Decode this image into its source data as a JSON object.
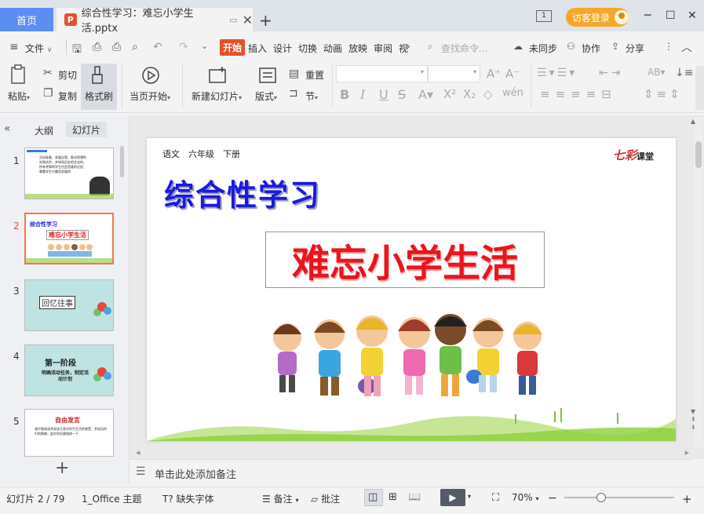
{
  "titlebar": {
    "home_tab": "首页",
    "doc_tab": "综合性学习：难忘小学生活.pptx",
    "window_num": "1",
    "login": "访客登录"
  },
  "menu": {
    "file": "文件",
    "tabs": [
      "开始",
      "插入",
      "设计",
      "切换",
      "动画",
      "放映",
      "审阅",
      "视"
    ],
    "search_placeholder": "查找命令...",
    "sync": "未同步",
    "collab": "协作",
    "share": "分享"
  },
  "ribbon": {
    "paste": "粘贴",
    "cut": "剪切",
    "copy": "复制",
    "format_painter": "格式刷",
    "from_current": "当页开始",
    "new_slide": "新建幻灯片",
    "layout": "版式",
    "reset": "重置",
    "section": "节"
  },
  "left_panel": {
    "tab_outline": "大纲",
    "tab_slides": "幻灯片",
    "slides": [
      {
        "num": "1",
        "text": "活动准备，发展自我，推动思想的实践进步，并体现历史的文化的，所有考察的学生在此思维的过程、尊重学生兴趣而发展的"
      },
      {
        "num": "2",
        "title": "综合性学习",
        "subtitle": "难忘小学生活"
      },
      {
        "num": "3",
        "text": "回忆往事"
      },
      {
        "num": "4",
        "title": "第一阶段",
        "text": "明确活动任务，制定活动计划"
      },
      {
        "num": "5",
        "title": "自由发言",
        "text": "请仔细阅读并说说大家对学生生活的感受，并说出你们的情感，此外你还要描述一下"
      }
    ]
  },
  "slide": {
    "header": "语文　六年级　下册",
    "logo_main": "七彩",
    "logo_sub": "课堂",
    "title": "综合性学习",
    "subtitle": "难忘小学生活"
  },
  "notes": {
    "placeholder": "单击此处添加备注"
  },
  "status": {
    "slide_pos": "幻灯片 2 / 79",
    "theme": "1_Office 主题",
    "missing_font": "缺失字体",
    "notes": "备注",
    "comments": "批注",
    "zoom": "70%"
  },
  "colors": {
    "accent": "#e5502b",
    "tab_blue": "#5b8ef0",
    "title_blue": "#1a1adf",
    "title_red": "#e8151b"
  }
}
